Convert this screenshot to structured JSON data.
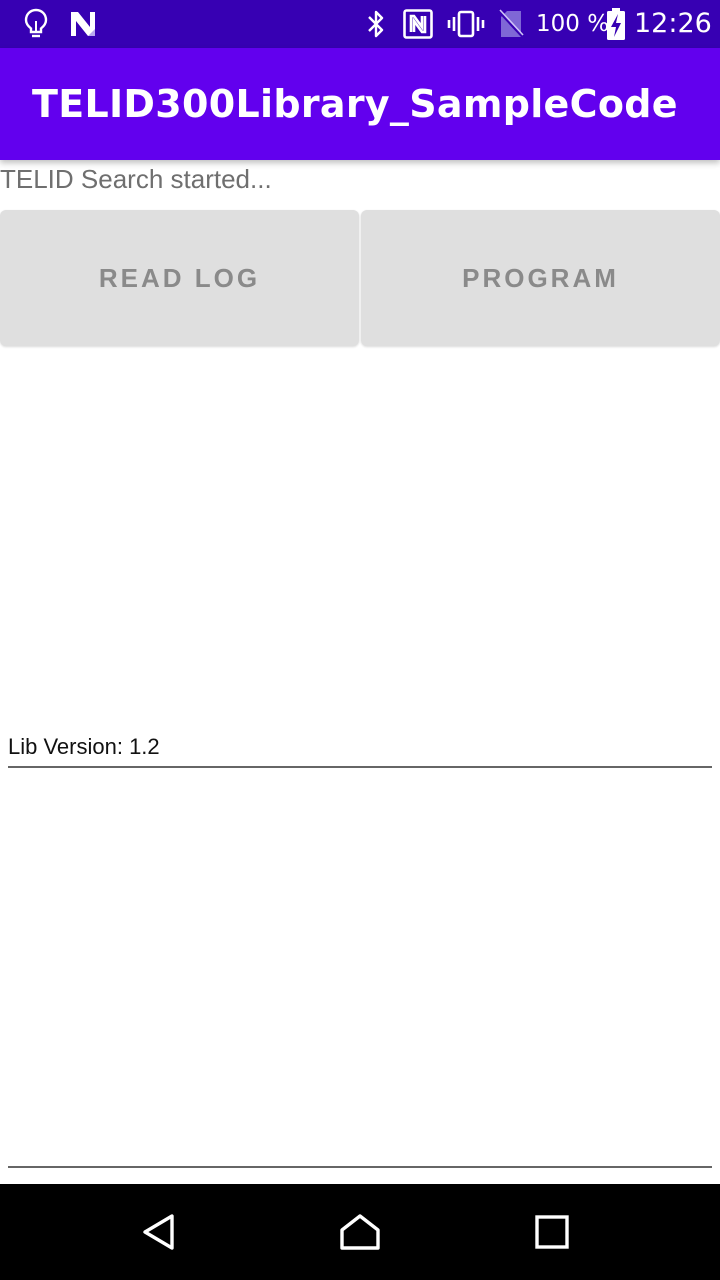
{
  "status_bar": {
    "battery_percent": "100 %",
    "time": "12:26",
    "icons": [
      "lightbulb-icon",
      "n-app-icon",
      "bluetooth-icon",
      "nfc-icon",
      "vibrate-icon",
      "no-sim-icon",
      "battery-charging-icon"
    ]
  },
  "app_bar": {
    "title": "TELID300Library_SampleCode"
  },
  "main": {
    "status_text": "TELID Search started...",
    "buttons": {
      "read_log": "READ LOG",
      "program": "PROGRAM"
    },
    "lib_version": "Lib Version: 1.2",
    "log_text": ""
  },
  "nav_bar": {
    "icons": [
      "back-icon",
      "home-icon",
      "recents-icon"
    ]
  },
  "colors": {
    "status_bar": "#3700b3",
    "app_bar": "#6200ee",
    "button_bg": "#dfdfdf",
    "button_text": "#8a8a8a"
  }
}
